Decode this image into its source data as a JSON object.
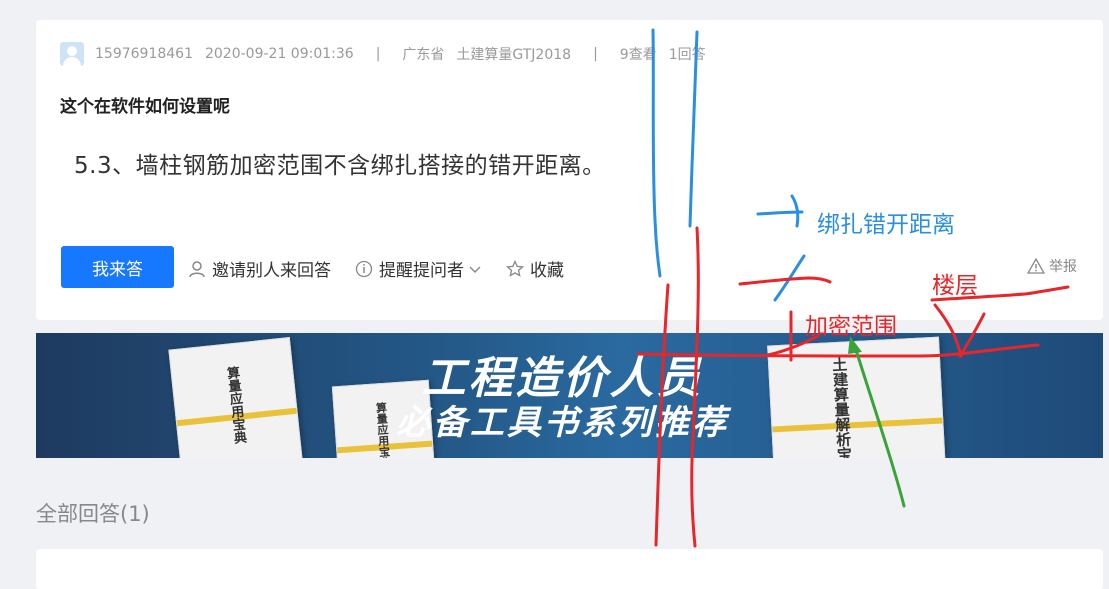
{
  "question": {
    "user": "15976918461",
    "datetime": "2020-09-21 09:01:36",
    "separator": "|",
    "region": "广东省",
    "software": "土建算量GTJ2018",
    "views": "9查看",
    "answers_count": "1回答",
    "title": "这个在软件如何设置呢",
    "body": "5.3、墙柱钢筋加密范围不含绑扎搭接的错开距离。"
  },
  "actions": {
    "answer_button": "我来答",
    "invite": "邀请别人来回答",
    "remind": "提醒提问者",
    "favorite": "收藏",
    "report": "举报"
  },
  "banner": {
    "line1": "工程造价人员",
    "line2": "必备工具书系列推荐",
    "book1_title": "算量应用宝典",
    "book2_title": "算量应用宝典",
    "book3_title": "土建算量解析宝典"
  },
  "answers_section": {
    "title": "全部回答(1)"
  },
  "annotations": {
    "stagger_label": "绑扎错开距离",
    "floor_label": "楼层",
    "dense_label": "加密范围",
    "blue": "#2b8fe0",
    "red": "#e8262a",
    "green": "#3aa33a"
  },
  "colors": {
    "primary": "#1677ff",
    "page_bg": "#f0f1f4"
  }
}
